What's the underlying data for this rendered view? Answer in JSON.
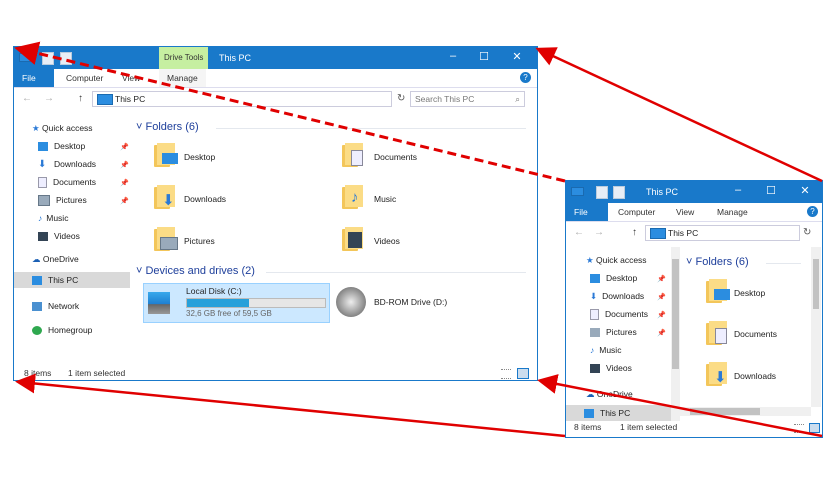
{
  "large": {
    "title": "This PC",
    "context_tab": "Drive Tools",
    "controls": {
      "minimize": "–",
      "maximize": "☐",
      "close": "✕"
    },
    "ribbon": {
      "file": "File",
      "tabs": [
        "Computer",
        "View",
        "Manage"
      ]
    },
    "address": {
      "path": "This PC",
      "search_placeholder": "Search This PC"
    },
    "sidebar": [
      {
        "label": "Quick access"
      },
      {
        "label": "Desktop"
      },
      {
        "label": "Downloads"
      },
      {
        "label": "Documents"
      },
      {
        "label": "Pictures"
      },
      {
        "label": "Music"
      },
      {
        "label": "Videos"
      },
      {
        "label": "OneDrive"
      },
      {
        "label": "This PC"
      },
      {
        "label": "Network"
      },
      {
        "label": "Homegroup"
      }
    ],
    "folders_header": "Folders (6)",
    "folders": [
      "Desktop",
      "Documents",
      "Downloads",
      "Music",
      "Pictures",
      "Videos"
    ],
    "devices_header": "Devices and drives (2)",
    "drives": [
      {
        "name": "Local Disk (C:)",
        "free": "32,6 GB free of 59,5 GB",
        "used_fraction": 0.45
      },
      {
        "name": "BD-ROM Drive (D:)"
      }
    ],
    "status": {
      "items": "8 items",
      "selected": "1 item selected"
    }
  },
  "small": {
    "title": "This PC",
    "ribbon": {
      "file": "File",
      "tabs": [
        "Computer",
        "View",
        "Manage"
      ]
    },
    "address": {
      "path": "This PC"
    },
    "sidebar": [
      "Quick access",
      "Desktop",
      "Downloads",
      "Documents",
      "Pictures",
      "Music",
      "Videos",
      "OneDrive",
      "This PC"
    ],
    "folders_header": "Folders (6)",
    "folders": [
      "Desktop",
      "Documents",
      "Downloads"
    ],
    "status": {
      "items": "8 items",
      "selected": "1 item selected"
    }
  },
  "colors": {
    "accent": "#1979ca",
    "arrow": "#e00000",
    "drive_tools": "#c6efa1"
  }
}
